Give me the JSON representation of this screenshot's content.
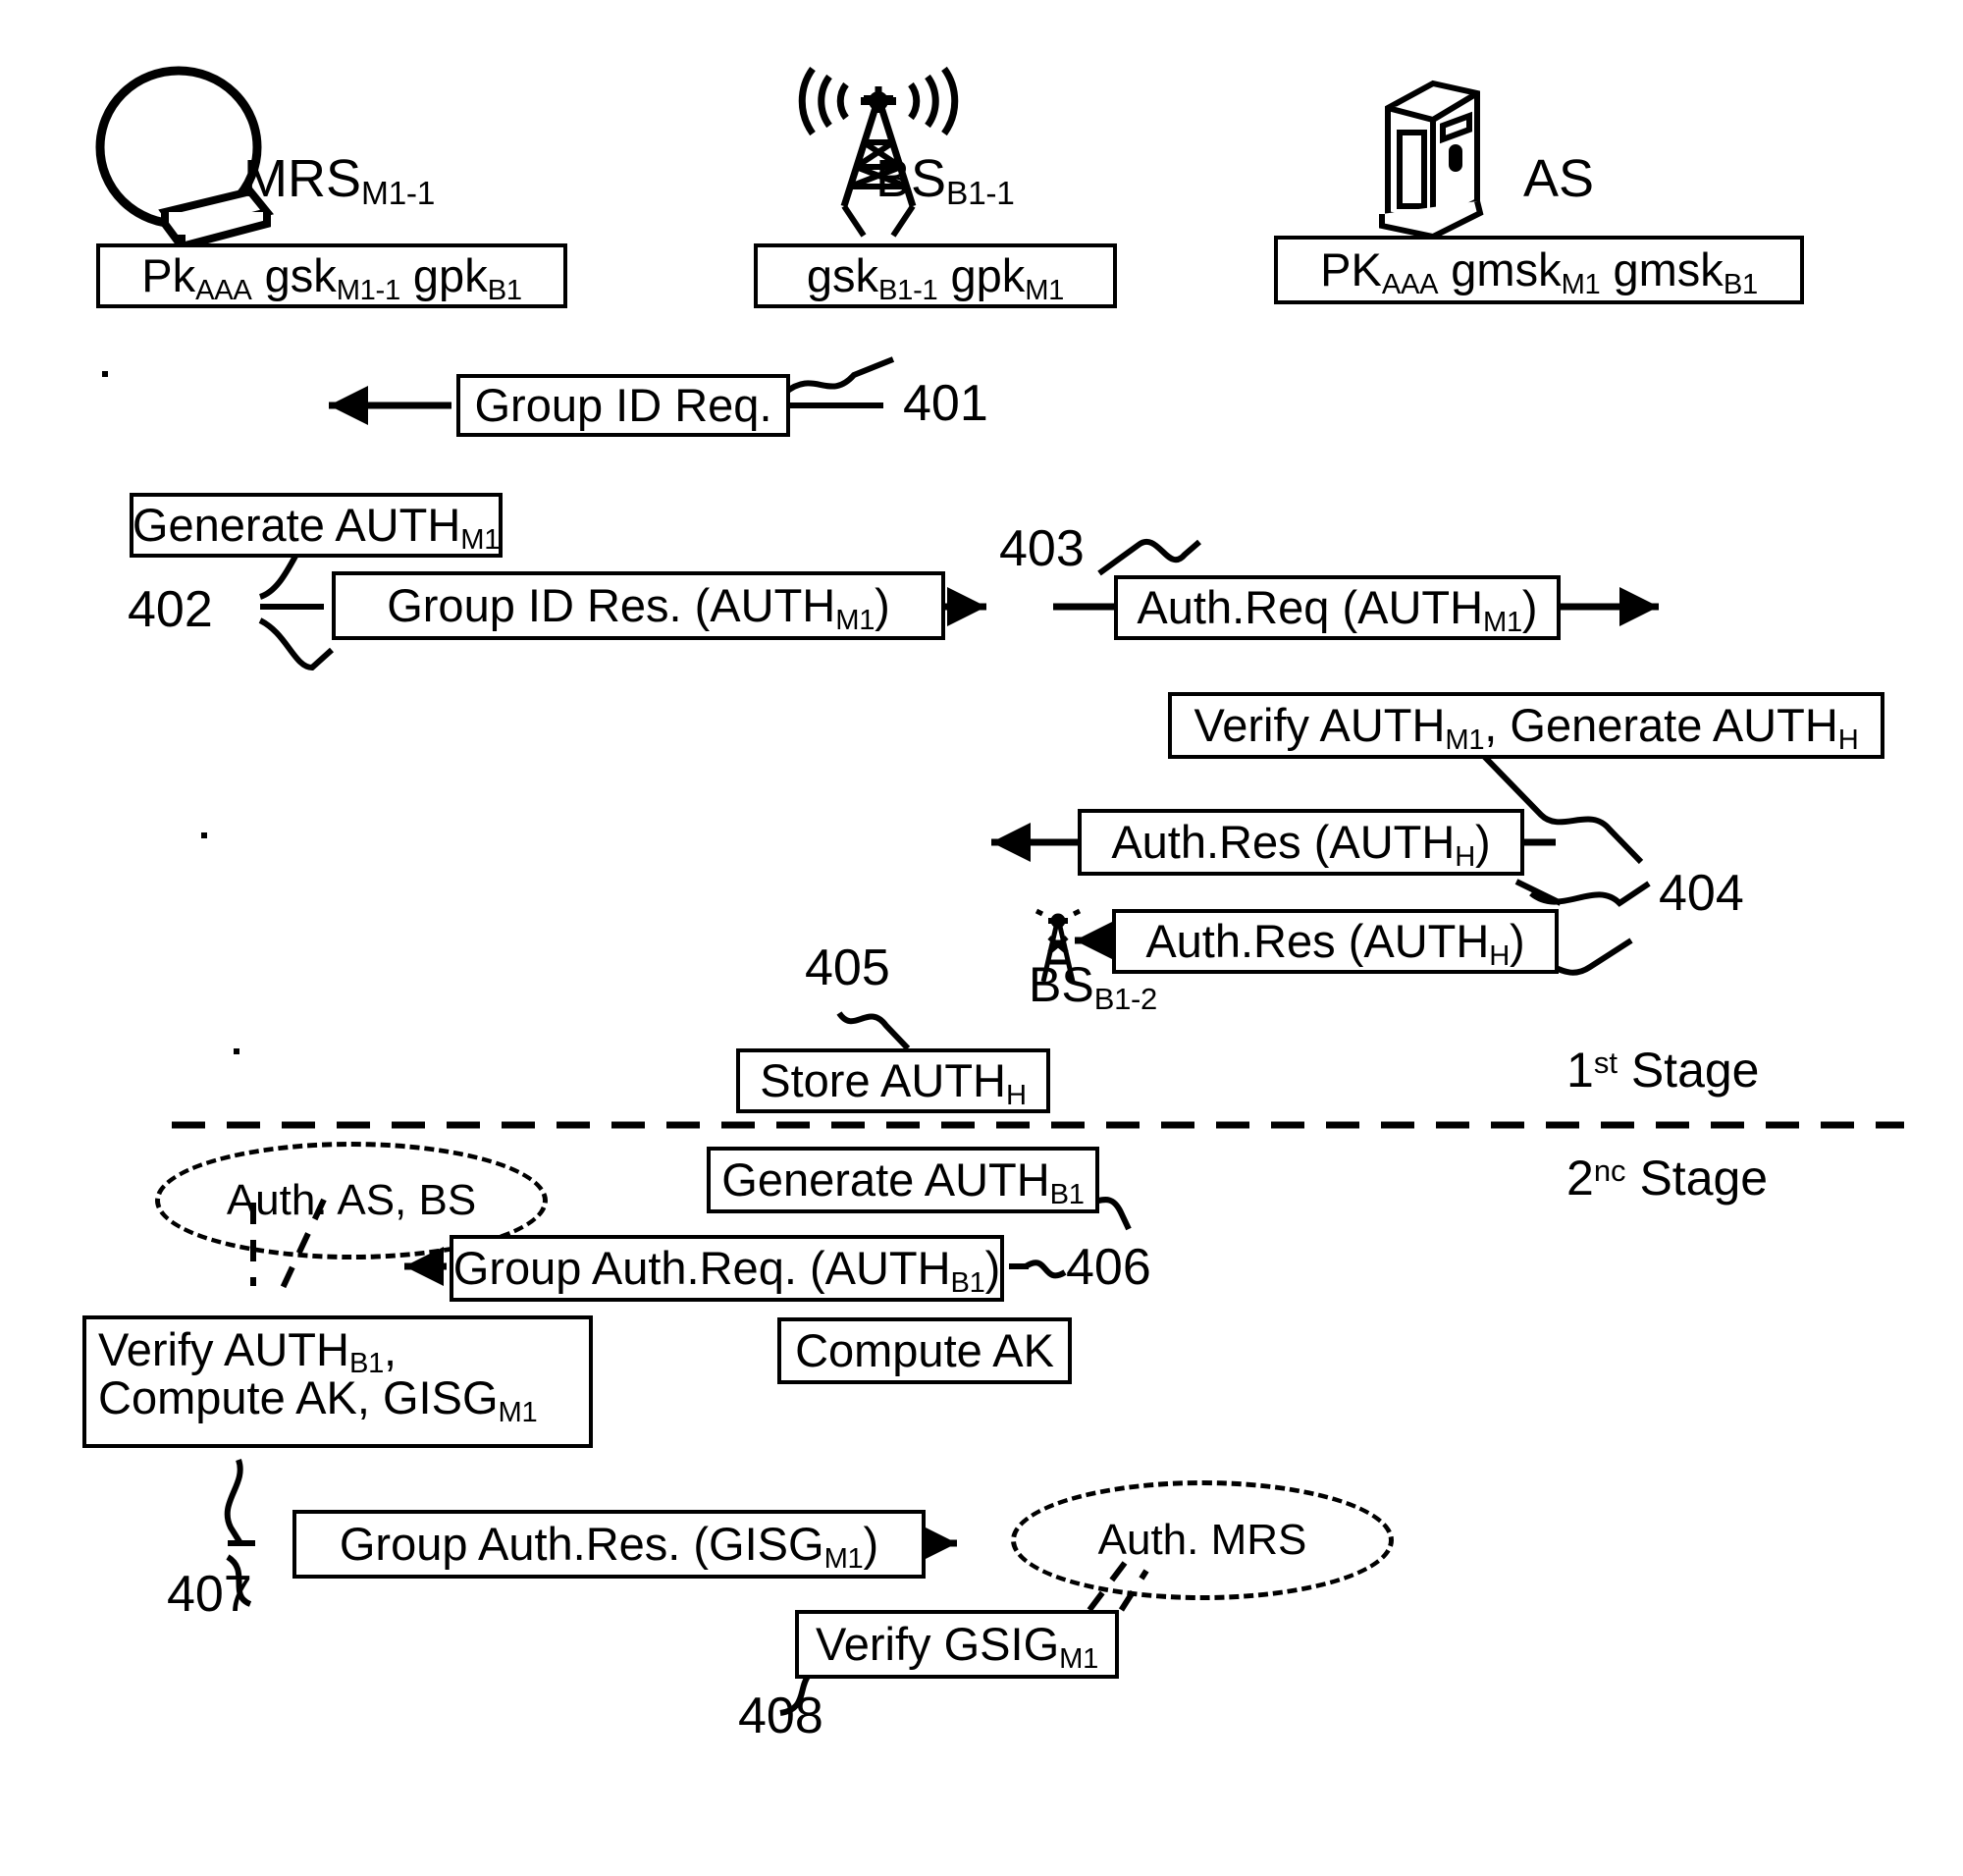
{
  "figure": {
    "type": "patent-sequence-diagram",
    "stages": [
      {
        "id": "stage-1",
        "label_prefix": "1",
        "label_sup": "st",
        "label_suffix": " Stage"
      },
      {
        "id": "stage-2",
        "label_prefix": "2",
        "label_sup": "nc",
        "label_suffix": " Stage"
      }
    ]
  },
  "nodes": [
    {
      "id": "mrs",
      "icon": "mobile-relay-station-icon",
      "name": "MRS",
      "subscript": "M1-1",
      "key_box": {
        "parts": [
          {
            "base": "Pk",
            "sub": "AAA"
          },
          {
            "base": "gsk",
            "sub": "M1-1"
          },
          {
            "base": "gpk",
            "sub": "B1"
          }
        ]
      }
    },
    {
      "id": "bs",
      "icon": "base-station-tower-icon",
      "name": "BS",
      "subscript": "B1-1",
      "key_box": {
        "parts": [
          {
            "base": "gsk",
            "sub": "B1-1"
          },
          {
            "base": "gpk",
            "sub": "M1"
          }
        ]
      }
    },
    {
      "id": "as",
      "icon": "server-cabinet-icon",
      "name": "AS",
      "subscript": "",
      "key_box": {
        "parts": [
          {
            "base": "PK",
            "sub": "AAA"
          },
          {
            "base": "gmsk",
            "sub": "M1"
          },
          {
            "base": "gmsk",
            "sub": "B1"
          }
        ]
      }
    }
  ],
  "secondary_nodes": [
    {
      "id": "bs-b1-2",
      "icon": "base-station-tower-icon",
      "name": "BS",
      "subscript": "B1-2"
    }
  ],
  "steps": [
    {
      "ref": "401",
      "kind": "message",
      "direction": "left",
      "stage": 1,
      "text": {
        "base": "Group ID Req.",
        "sub": ""
      }
    },
    {
      "ref": "",
      "kind": "process",
      "stage": 1,
      "text": {
        "base": "Generate AUTH",
        "sub": "M1"
      }
    },
    {
      "ref": "402",
      "kind": "message",
      "direction": "right",
      "stage": 1,
      "text": {
        "base": "Group ID Res. (AUTH",
        "sub": "M1",
        "tail": ")"
      }
    },
    {
      "ref": "403",
      "kind": "message",
      "direction": "right",
      "stage": 1,
      "text": {
        "base": "Auth.Req (AUTH",
        "sub": "M1",
        "tail": ")"
      }
    },
    {
      "ref": "",
      "kind": "process",
      "stage": 1,
      "text": {
        "base": "Verify AUTH",
        "sub": "M1",
        "mid": ", Generate AUTH",
        "sub2": "H"
      }
    },
    {
      "ref": "404",
      "kind": "message",
      "direction": "left",
      "stage": 1,
      "text": {
        "base": "Auth.Res (AUTH",
        "sub": "H",
        "tail": ")"
      }
    },
    {
      "ref": "404",
      "kind": "message",
      "direction": "left",
      "stage": 1,
      "text": {
        "base": "Auth.Res (AUTH",
        "sub": "H",
        "tail": ")"
      }
    },
    {
      "ref": "405",
      "kind": "process",
      "stage": 1,
      "text": {
        "base": "Store AUTH",
        "sub": "H"
      }
    },
    {
      "ref": "",
      "kind": "process",
      "stage": 2,
      "text": {
        "base": "Generate AUTH",
        "sub": "B1"
      }
    },
    {
      "ref": "406",
      "kind": "message",
      "direction": "left",
      "stage": 2,
      "text": {
        "base": "Group Auth.Req. (AUTH",
        "sub": "B1",
        "tail": ")"
      }
    },
    {
      "ref": "",
      "kind": "process",
      "stage": 2,
      "text": {
        "base": "Compute AK",
        "sub": ""
      }
    },
    {
      "ref": "",
      "kind": "process",
      "stage": 2,
      "line1": {
        "base": "Verify AUTH",
        "sub": "B1",
        "tail": ","
      },
      "line2": {
        "base": "Compute AK, GISG",
        "sub": "M1"
      }
    },
    {
      "ref": "407",
      "kind": "message",
      "direction": "right",
      "stage": 2,
      "text": {
        "base": "Group Auth.Res. (GISG",
        "sub": "M1",
        "tail": ")"
      }
    },
    {
      "ref": "408",
      "kind": "process",
      "stage": 2,
      "text": {
        "base": "Verify GSIG",
        "sub": "M1"
      }
    }
  ],
  "callouts": [
    {
      "id": "callout-auth-as-bs",
      "text": "Auth. AS, BS"
    },
    {
      "id": "callout-auth-mrs",
      "text": "Auth. MRS"
    }
  ],
  "labels": {
    "mrs_name": "MRS",
    "mrs_sub": "M1-1",
    "bs_name": "BS",
    "bs_sub": "B1-1",
    "as_name": "AS",
    "bs2_name": "BS",
    "bs2_sub": "B1-2",
    "ref_401": "401",
    "ref_402": "402",
    "ref_403": "403",
    "ref_404": "404",
    "ref_405": "405",
    "ref_406": "406",
    "ref_407": "407",
    "ref_408": "408",
    "stage1_num": "1",
    "stage1_sup": "st",
    "stage1_word": " Stage",
    "stage2_num": "2",
    "stage2_sup": "nc",
    "stage2_word": " Stage",
    "key_mrs_1": "Pk",
    "key_mrs_1_sub": "AAA",
    "key_mrs_2": "gsk",
    "key_mrs_2_sub": "M1-1",
    "key_mrs_3": "gpk",
    "key_mrs_3_sub": "B1",
    "key_bs_1": "gsk",
    "key_bs_1_sub": "B1-1",
    "key_bs_2": "gpk",
    "key_bs_2_sub": "M1",
    "key_as_1": "PK",
    "key_as_1_sub": "AAA",
    "key_as_2": "gmsk",
    "key_as_2_sub": "M1",
    "key_as_3": "gmsk",
    "key_as_3_sub": "B1",
    "msg_401": "Group ID Req.",
    "proc_gen_authm1": "Generate AUTH",
    "proc_gen_authm1_sub": "M1",
    "msg_402": "Group ID Res. (AUTH",
    "msg_402_sub": "M1",
    "msg_402_tail": ")",
    "msg_403": "Auth.Req (AUTH",
    "msg_403_sub": "M1",
    "msg_403_tail": ")",
    "proc_verify_gen": "Verify AUTH",
    "proc_verify_gen_sub": "M1",
    "proc_verify_gen_mid": ", Generate AUTH",
    "proc_verify_gen_sub2": "H",
    "msg_404a": "Auth.Res (AUTH",
    "msg_404a_sub": "H",
    "msg_404a_tail": ")",
    "msg_404b": "Auth.Res (AUTH",
    "msg_404b_sub": "H",
    "msg_404b_tail": ")",
    "proc_store": "Store AUTH",
    "proc_store_sub": "H",
    "callout_as_bs": "Auth. AS, BS",
    "proc_gen_authb1": "Generate AUTH",
    "proc_gen_authb1_sub": "B1",
    "msg_406": "Group Auth.Req. (AUTH",
    "msg_406_sub": "B1",
    "msg_406_tail": ")",
    "proc_compute_ak": "Compute AK",
    "proc_verify_b1_l1": "Verify AUTH",
    "proc_verify_b1_l1_sub": "B1",
    "proc_verify_b1_l1_tail": ",",
    "proc_verify_b1_l2": "Compute AK, GISG",
    "proc_verify_b1_l2_sub": "M1",
    "msg_407": "Group Auth.Res. (GISG",
    "msg_407_sub": "M1",
    "msg_407_tail": ")",
    "callout_mrs": "Auth. MRS",
    "proc_verify_gsig": "Verify GSIG",
    "proc_verify_gsig_sub": "M1"
  }
}
